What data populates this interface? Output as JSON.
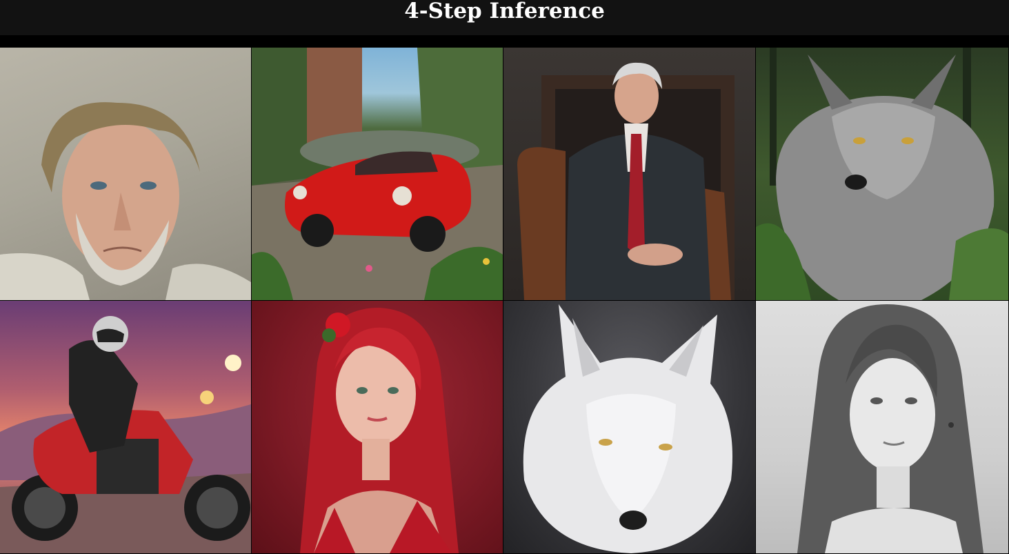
{
  "header": {
    "title": "4-Step Inference"
  },
  "gallery": {
    "images": [
      {
        "subject": "portrait-older-man-painting"
      },
      {
        "subject": "red-sports-car-river"
      },
      {
        "subject": "man-in-suit-chair-portrait"
      },
      {
        "subject": "gray-wolf-forest"
      },
      {
        "subject": "motorcycle-rider-sunset"
      },
      {
        "subject": "red-haired-woman-portrait"
      },
      {
        "subject": "white-wolf-portrait"
      },
      {
        "subject": "pencil-sketch-woman"
      }
    ]
  }
}
